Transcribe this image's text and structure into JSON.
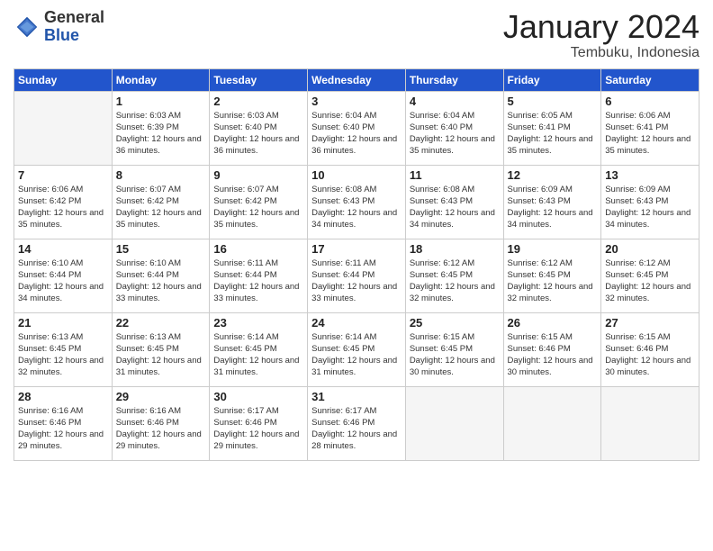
{
  "header": {
    "logo_general": "General",
    "logo_blue": "Blue",
    "title": "January 2024",
    "location": "Tembuku, Indonesia"
  },
  "weekdays": [
    "Sunday",
    "Monday",
    "Tuesday",
    "Wednesday",
    "Thursday",
    "Friday",
    "Saturday"
  ],
  "weeks": [
    [
      {
        "day": "",
        "sunrise": "",
        "sunset": "",
        "daylight": ""
      },
      {
        "day": "1",
        "sunrise": "Sunrise: 6:03 AM",
        "sunset": "Sunset: 6:39 PM",
        "daylight": "Daylight: 12 hours and 36 minutes."
      },
      {
        "day": "2",
        "sunrise": "Sunrise: 6:03 AM",
        "sunset": "Sunset: 6:40 PM",
        "daylight": "Daylight: 12 hours and 36 minutes."
      },
      {
        "day": "3",
        "sunrise": "Sunrise: 6:04 AM",
        "sunset": "Sunset: 6:40 PM",
        "daylight": "Daylight: 12 hours and 36 minutes."
      },
      {
        "day": "4",
        "sunrise": "Sunrise: 6:04 AM",
        "sunset": "Sunset: 6:40 PM",
        "daylight": "Daylight: 12 hours and 35 minutes."
      },
      {
        "day": "5",
        "sunrise": "Sunrise: 6:05 AM",
        "sunset": "Sunset: 6:41 PM",
        "daylight": "Daylight: 12 hours and 35 minutes."
      },
      {
        "day": "6",
        "sunrise": "Sunrise: 6:06 AM",
        "sunset": "Sunset: 6:41 PM",
        "daylight": "Daylight: 12 hours and 35 minutes."
      }
    ],
    [
      {
        "day": "7",
        "sunrise": "Sunrise: 6:06 AM",
        "sunset": "Sunset: 6:42 PM",
        "daylight": "Daylight: 12 hours and 35 minutes."
      },
      {
        "day": "8",
        "sunrise": "Sunrise: 6:07 AM",
        "sunset": "Sunset: 6:42 PM",
        "daylight": "Daylight: 12 hours and 35 minutes."
      },
      {
        "day": "9",
        "sunrise": "Sunrise: 6:07 AM",
        "sunset": "Sunset: 6:42 PM",
        "daylight": "Daylight: 12 hours and 35 minutes."
      },
      {
        "day": "10",
        "sunrise": "Sunrise: 6:08 AM",
        "sunset": "Sunset: 6:43 PM",
        "daylight": "Daylight: 12 hours and 34 minutes."
      },
      {
        "day": "11",
        "sunrise": "Sunrise: 6:08 AM",
        "sunset": "Sunset: 6:43 PM",
        "daylight": "Daylight: 12 hours and 34 minutes."
      },
      {
        "day": "12",
        "sunrise": "Sunrise: 6:09 AM",
        "sunset": "Sunset: 6:43 PM",
        "daylight": "Daylight: 12 hours and 34 minutes."
      },
      {
        "day": "13",
        "sunrise": "Sunrise: 6:09 AM",
        "sunset": "Sunset: 6:43 PM",
        "daylight": "Daylight: 12 hours and 34 minutes."
      }
    ],
    [
      {
        "day": "14",
        "sunrise": "Sunrise: 6:10 AM",
        "sunset": "Sunset: 6:44 PM",
        "daylight": "Daylight: 12 hours and 34 minutes."
      },
      {
        "day": "15",
        "sunrise": "Sunrise: 6:10 AM",
        "sunset": "Sunset: 6:44 PM",
        "daylight": "Daylight: 12 hours and 33 minutes."
      },
      {
        "day": "16",
        "sunrise": "Sunrise: 6:11 AM",
        "sunset": "Sunset: 6:44 PM",
        "daylight": "Daylight: 12 hours and 33 minutes."
      },
      {
        "day": "17",
        "sunrise": "Sunrise: 6:11 AM",
        "sunset": "Sunset: 6:44 PM",
        "daylight": "Daylight: 12 hours and 33 minutes."
      },
      {
        "day": "18",
        "sunrise": "Sunrise: 6:12 AM",
        "sunset": "Sunset: 6:45 PM",
        "daylight": "Daylight: 12 hours and 32 minutes."
      },
      {
        "day": "19",
        "sunrise": "Sunrise: 6:12 AM",
        "sunset": "Sunset: 6:45 PM",
        "daylight": "Daylight: 12 hours and 32 minutes."
      },
      {
        "day": "20",
        "sunrise": "Sunrise: 6:12 AM",
        "sunset": "Sunset: 6:45 PM",
        "daylight": "Daylight: 12 hours and 32 minutes."
      }
    ],
    [
      {
        "day": "21",
        "sunrise": "Sunrise: 6:13 AM",
        "sunset": "Sunset: 6:45 PM",
        "daylight": "Daylight: 12 hours and 32 minutes."
      },
      {
        "day": "22",
        "sunrise": "Sunrise: 6:13 AM",
        "sunset": "Sunset: 6:45 PM",
        "daylight": "Daylight: 12 hours and 31 minutes."
      },
      {
        "day": "23",
        "sunrise": "Sunrise: 6:14 AM",
        "sunset": "Sunset: 6:45 PM",
        "daylight": "Daylight: 12 hours and 31 minutes."
      },
      {
        "day": "24",
        "sunrise": "Sunrise: 6:14 AM",
        "sunset": "Sunset: 6:45 PM",
        "daylight": "Daylight: 12 hours and 31 minutes."
      },
      {
        "day": "25",
        "sunrise": "Sunrise: 6:15 AM",
        "sunset": "Sunset: 6:45 PM",
        "daylight": "Daylight: 12 hours and 30 minutes."
      },
      {
        "day": "26",
        "sunrise": "Sunrise: 6:15 AM",
        "sunset": "Sunset: 6:46 PM",
        "daylight": "Daylight: 12 hours and 30 minutes."
      },
      {
        "day": "27",
        "sunrise": "Sunrise: 6:15 AM",
        "sunset": "Sunset: 6:46 PM",
        "daylight": "Daylight: 12 hours and 30 minutes."
      }
    ],
    [
      {
        "day": "28",
        "sunrise": "Sunrise: 6:16 AM",
        "sunset": "Sunset: 6:46 PM",
        "daylight": "Daylight: 12 hours and 29 minutes."
      },
      {
        "day": "29",
        "sunrise": "Sunrise: 6:16 AM",
        "sunset": "Sunset: 6:46 PM",
        "daylight": "Daylight: 12 hours and 29 minutes."
      },
      {
        "day": "30",
        "sunrise": "Sunrise: 6:17 AM",
        "sunset": "Sunset: 6:46 PM",
        "daylight": "Daylight: 12 hours and 29 minutes."
      },
      {
        "day": "31",
        "sunrise": "Sunrise: 6:17 AM",
        "sunset": "Sunset: 6:46 PM",
        "daylight": "Daylight: 12 hours and 28 minutes."
      },
      {
        "day": "",
        "sunrise": "",
        "sunset": "",
        "daylight": ""
      },
      {
        "day": "",
        "sunrise": "",
        "sunset": "",
        "daylight": ""
      },
      {
        "day": "",
        "sunrise": "",
        "sunset": "",
        "daylight": ""
      }
    ]
  ]
}
